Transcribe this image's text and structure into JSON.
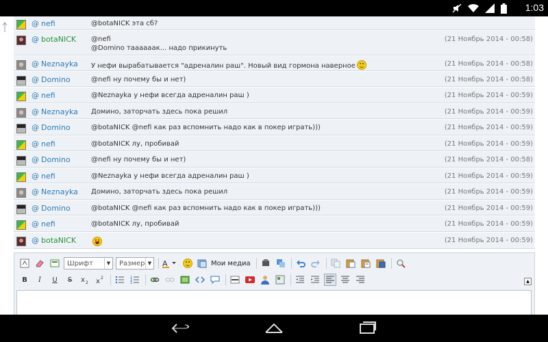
{
  "status_bar": {
    "time": "1:03"
  },
  "chat": {
    "rows": [
      {
        "avatar": "green-yellow",
        "user": "nefi",
        "user_color": "#2c7ab8",
        "msg": "@botaNICK эта сб?",
        "msg2": "",
        "time": "",
        "emoji": ""
      },
      {
        "avatar": "dark-portrait",
        "user": "botaNICK",
        "user_color": "#2a8f3c",
        "msg": "@nefi",
        "msg2": "@Domino таааааак... надо прикинуть",
        "time": "(21 Ноябрь 2014 - 00:58)",
        "emoji": ""
      },
      {
        "avatar": "grey-portrait",
        "user": "Neznayka",
        "user_color": "#2c7ab8",
        "msg": "У нефи вырабатывается \"адреналин раш\". Новый вид гормона наверное",
        "msg2": "",
        "time": "(21 Ноябрь 2014 - 00:58)",
        "emoji": "smile"
      },
      {
        "avatar": "bw-portrait",
        "user": "Domino",
        "user_color": "#2c7ab8",
        "msg": "@nefi ну почему бы и нет)",
        "msg2": "",
        "time": "(21 Ноябрь 2014 - 00:58)",
        "emoji": ""
      },
      {
        "avatar": "green-yellow",
        "user": "nefi",
        "user_color": "#2c7ab8",
        "msg": "@Neznayka у нефи всегда адреналин раш )",
        "msg2": "",
        "time": "(21 Ноябрь 2014 - 00:59)",
        "emoji": ""
      },
      {
        "avatar": "grey-portrait",
        "user": "Neznayka",
        "user_color": "#2c7ab8",
        "msg": "Домино, заторчать здесь пока решил",
        "msg2": "",
        "time": "(21 Ноябрь 2014 - 00:59)",
        "emoji": ""
      },
      {
        "avatar": "bw-portrait",
        "user": "Domino",
        "user_color": "#2c7ab8",
        "msg": "@botaNICK @nefi как раз вспомнить надо как в покер играть)))",
        "msg2": "",
        "time": "(21 Ноябрь 2014 - 00:59)",
        "emoji": ""
      },
      {
        "avatar": "green-yellow",
        "user": "nefi",
        "user_color": "#2c7ab8",
        "msg": "@botaNICK лу, пробивай",
        "msg2": "",
        "time": "(21 Ноябрь 2014 - 00:59)",
        "emoji": ""
      },
      {
        "avatar": "bw-portrait",
        "user": "Domino",
        "user_color": "#2c7ab8",
        "msg": "@nefi ну почему бы и нет)",
        "msg2": "",
        "time": "(21 Ноябрь 2014 - 00:58)",
        "emoji": ""
      },
      {
        "avatar": "green-yellow",
        "user": "nefi",
        "user_color": "#2c7ab8",
        "msg": "@Neznayka у нефи всегда адреналин раш )",
        "msg2": "",
        "time": "(21 Ноябрь 2014 - 00:59)",
        "emoji": ""
      },
      {
        "avatar": "grey-portrait",
        "user": "Neznayka",
        "user_color": "#2c7ab8",
        "msg": "Домино, заторчать здесь пока решил",
        "msg2": "",
        "time": "(21 Ноябрь 2014 - 00:59)",
        "emoji": ""
      },
      {
        "avatar": "bw-portrait",
        "user": "Domino",
        "user_color": "#2c7ab8",
        "msg": "@botaNICK @nefi как раз вспомнить надо как в покер играть)))",
        "msg2": "",
        "time": "(21 Ноябрь 2014 - 00:59)",
        "emoji": ""
      },
      {
        "avatar": "green-yellow",
        "user": "nefi",
        "user_color": "#2c7ab8",
        "msg": "@botaNICK лу, пробивай",
        "msg2": "",
        "time": "(21 Ноябрь 2014 - 00:59)",
        "emoji": ""
      },
      {
        "avatar": "dark-portrait",
        "user": "botaNICK",
        "user_color": "#2a8f3c",
        "msg": "",
        "msg2": "",
        "time": "(21 Ноябрь 2014 - 00:59)",
        "emoji": "laugh"
      }
    ]
  },
  "editor": {
    "font_combo": "Шрифт",
    "size_combo": "Размер",
    "media_label": "Мои медиа"
  },
  "colors": {
    "row_bg": "#eef2f6",
    "link_blue": "#2c7ab8",
    "user_green": "#2a8f3c"
  }
}
